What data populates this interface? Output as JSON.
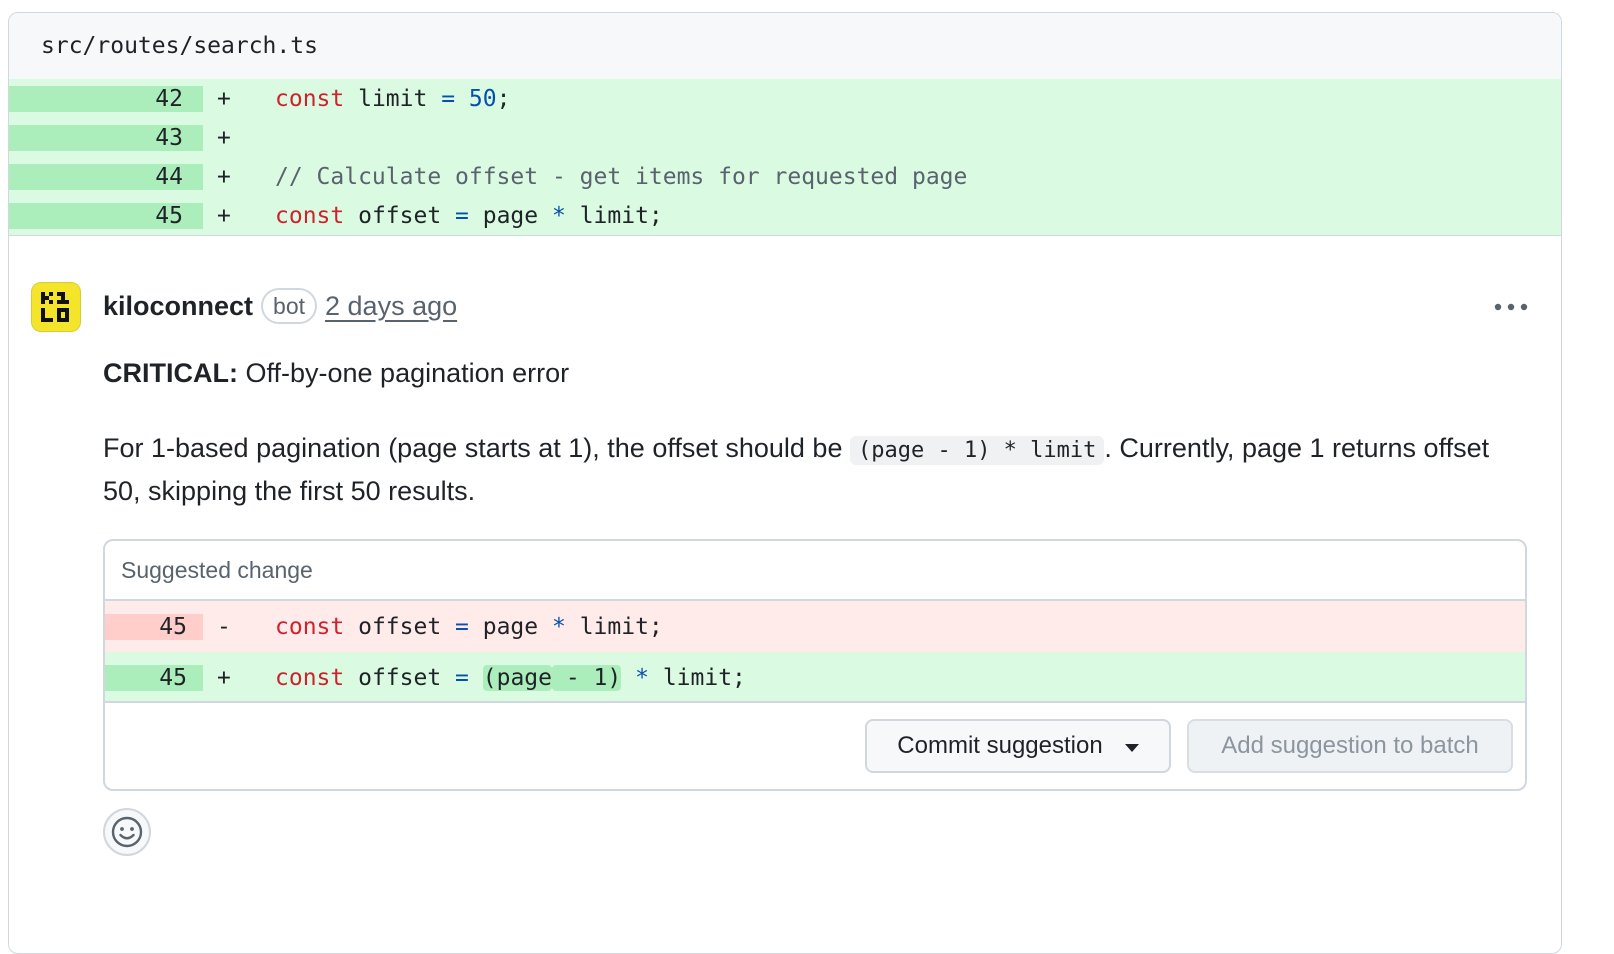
{
  "file": {
    "path": "src/routes/search.ts"
  },
  "diff": [
    {
      "line": "42",
      "sign": "+",
      "tokens": {
        "kw": "const",
        "a": " limit ",
        "op": "=",
        "b": " ",
        "num": "50",
        "c": ";"
      }
    },
    {
      "line": "43",
      "sign": "+"
    },
    {
      "line": "44",
      "sign": "+",
      "comment": "// Calculate offset - get items for requested page"
    },
    {
      "line": "45",
      "sign": "+",
      "tokens": {
        "kw": "const",
        "a": " offset ",
        "op": "=",
        "b": " page ",
        "op2": "*",
        "c": " limit;"
      }
    }
  ],
  "comment": {
    "author": "kiloconnect",
    "badge": "bot",
    "time": "2 days ago",
    "more_icon": "kebab-horizontal-icon",
    "title_bold": "CRITICAL:",
    "title_rest": " Off-by-one pagination error",
    "body_part1": "For 1-based pagination (page starts at 1), the offset should be ",
    "body_code": "(page - 1) * limit",
    "body_part2": ". Currently, page 1 returns offset 50, skipping the first 50 results."
  },
  "suggestion": {
    "header": "Suggested change",
    "removed": {
      "line": "45",
      "sign": "-",
      "kw": "const",
      "a": " offset ",
      "op": "=",
      "b": " page ",
      "op2": "*",
      "c": " limit;"
    },
    "added": {
      "line": "45",
      "sign": "+",
      "kw": "const",
      "a": " offset ",
      "op": "=",
      "b": " ",
      "hl1": "(page",
      "hl2": " - 1)",
      "sp": " ",
      "op2": "*",
      "c": " limit;"
    },
    "commit_label": "Commit suggestion",
    "batch_label": "Add suggestion to batch"
  },
  "reaction": {
    "icon": "smiley-icon"
  },
  "colors": {
    "add_bg": "#dafbe1",
    "add_num_bg": "#aceebb",
    "del_bg": "#ffebe9",
    "del_num_bg": "#ffcecb",
    "keyword": "#cf222e",
    "number": "#0550ae",
    "avatar": "#f5e52a"
  }
}
